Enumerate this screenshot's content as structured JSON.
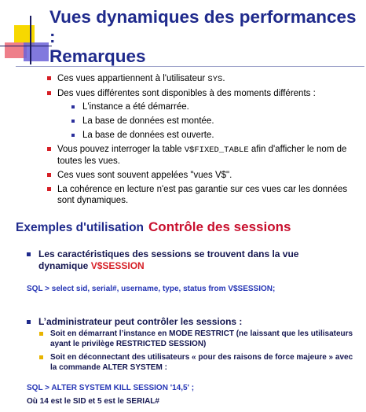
{
  "header": {
    "title_line1": "Vues dynamiques des performances :",
    "title_line2": "Remarques"
  },
  "remarks": {
    "item1_pre": "Ces vues appartiennent à l'utilisateur ",
    "item1_code": "SYS",
    "item1_post": ".",
    "item2": "Des vues différentes sont disponibles à des moments différents :",
    "sub_items": [
      "L'instance a été démarrée.",
      "La base de données est montée.",
      "La base de données est ouverte."
    ],
    "item3_pre": "Vous pouvez interroger la table ",
    "item3_code": "V$FIXED_TABLE",
    "item3_post": " afin d'afficher le nom de toutes les vues.",
    "item4": "Ces vues sont souvent appelées \"vues V$\".",
    "item5": "La cohérence en lecture n'est pas garantie sur ces vues car les données sont dynamiques."
  },
  "section2": {
    "heading_left": "Exemples d'utilisation",
    "heading_right": "Contrôle des sessions",
    "point1_text": "Les caractéristiques des sessions se trouvent dans la vue dynamique ",
    "point1_highlight": "V$SESSION",
    "sql1": "SQL > select sid, serial#, username, type, status from V$SESSION;",
    "point2_text": "L’administrateur peut contrôler les sessions :",
    "point2_subs": [
      "Soit en démarrant l’instance en MODE RESTRICT (ne laissant que les utilisateurs ayant le privilège RESTRICTED SESSION)",
      "Soit en déconnectant des utilisateurs « pour des raisons de force majeure » avec la commande ALTER SYSTEM :"
    ],
    "sql2": "SQL > ALTER SYSTEM KILL SESSION '14,5' ;",
    "footer": "Où 14 est le SID et 5 est le SERIAL#"
  },
  "colors": {
    "title": "#1f2a8c",
    "red_accent": "#d61f26",
    "sql_blue": "#2535b5",
    "yellow_bullet": "#e8b400"
  }
}
